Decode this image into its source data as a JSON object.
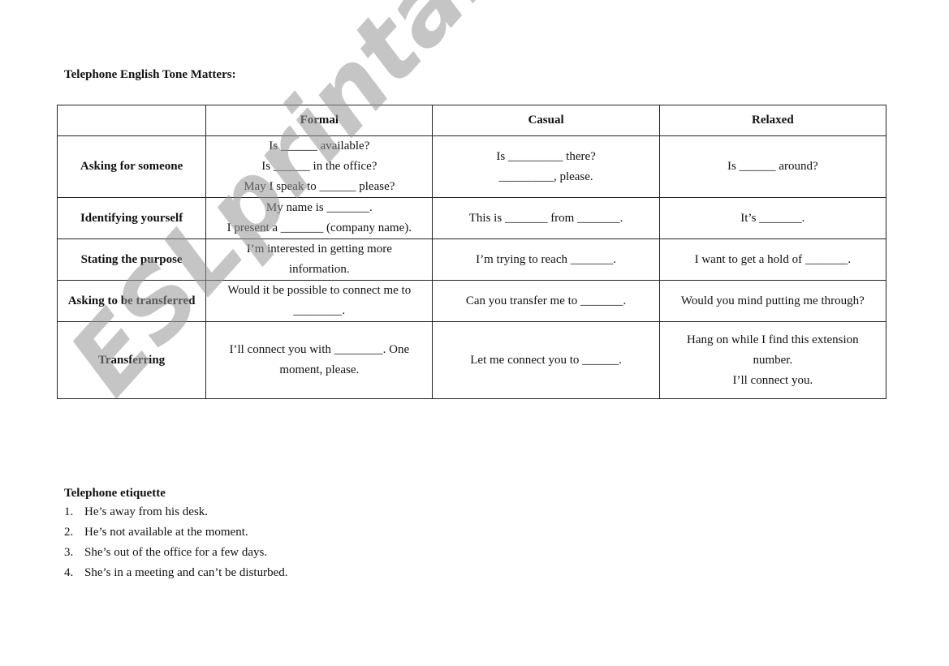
{
  "title": "Telephone English Tone Matters:",
  "table": {
    "headers": [
      "",
      "Formal",
      "Casual",
      "Relaxed"
    ],
    "rows": [
      {
        "label": "Asking for someone",
        "formal": [
          "Is ______ available?",
          "Is ______ in the office?",
          "May I speak to ______ please?"
        ],
        "casual": [
          "Is _________ there?",
          "_________, please."
        ],
        "relaxed": [
          "Is ______ around?"
        ]
      },
      {
        "label": "Identifying yourself",
        "formal": [
          "My name is _______.",
          "I present a _______ (company name)."
        ],
        "casual": [
          "This is _______ from _______."
        ],
        "relaxed": [
          "It’s _______."
        ]
      },
      {
        "label": "Stating the purpose",
        "formal": [
          "I’m interested in getting more",
          "information."
        ],
        "casual": [
          "I’m trying to reach _______."
        ],
        "relaxed": [
          "I want to get a hold of _______."
        ]
      },
      {
        "label": "Asking to be transferred",
        "formal": [
          "Would it be possible to connect me to",
          "________."
        ],
        "casual": [
          "Can you transfer me to _______."
        ],
        "relaxed": [
          "Would you mind putting me through?"
        ]
      },
      {
        "label": "Transferring",
        "formal": [
          "I’ll connect you with ________. One",
          "moment, please."
        ],
        "casual": [
          "Let me connect you to ______."
        ],
        "relaxed": [
          "Hang on while I find this extension",
          "number.",
          "I’ll connect you."
        ]
      }
    ]
  },
  "etiquette": {
    "title": "Telephone etiquette",
    "items": [
      {
        "num": "1.",
        "text": "He’s away from his desk."
      },
      {
        "num": "2.",
        "text": "He’s not available at the moment."
      },
      {
        "num": "3.",
        "text": "She’s out of the office for a few days."
      },
      {
        "num": "4.",
        "text": "She’s in a meeting and can’t be disturbed."
      }
    ]
  },
  "watermark": "ESLprintables.com"
}
